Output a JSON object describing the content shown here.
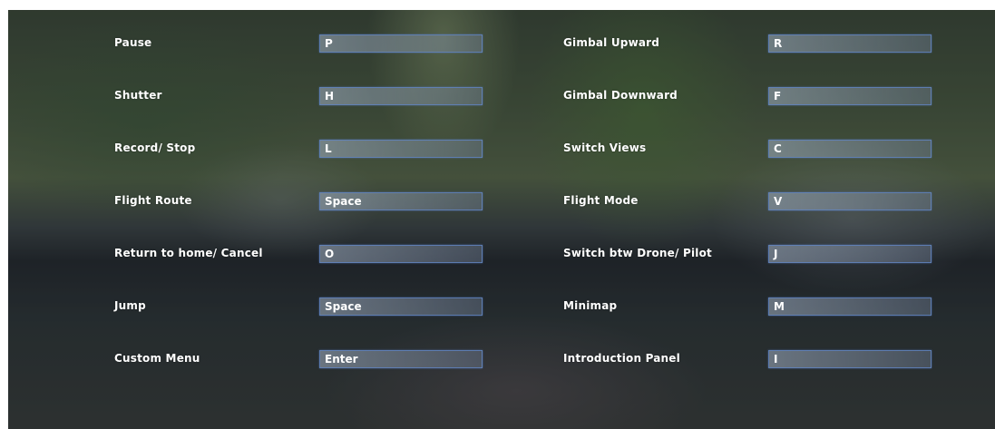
{
  "left_column": [
    {
      "label": "Pause",
      "key": "P"
    },
    {
      "label": "Shutter",
      "key": "H"
    },
    {
      "label": "Record/ Stop",
      "key": "L"
    },
    {
      "label": "Flight Route",
      "key": "Space"
    },
    {
      "label": "Return to home/ Cancel",
      "key": "O"
    },
    {
      "label": "Jump",
      "key": "Space"
    },
    {
      "label": "Custom Menu",
      "key": "Enter"
    }
  ],
  "right_column": [
    {
      "label": "Gimbal Upward",
      "key": "R"
    },
    {
      "label": "Gimbal Downward",
      "key": "F"
    },
    {
      "label": "Switch Views",
      "key": "C"
    },
    {
      "label": "Flight Mode",
      "key": "V"
    },
    {
      "label": "Switch btw Drone/ Pilot",
      "key": "J"
    },
    {
      "label": "Minimap",
      "key": "M"
    },
    {
      "label": "Introduction Panel",
      "key": "I"
    }
  ]
}
